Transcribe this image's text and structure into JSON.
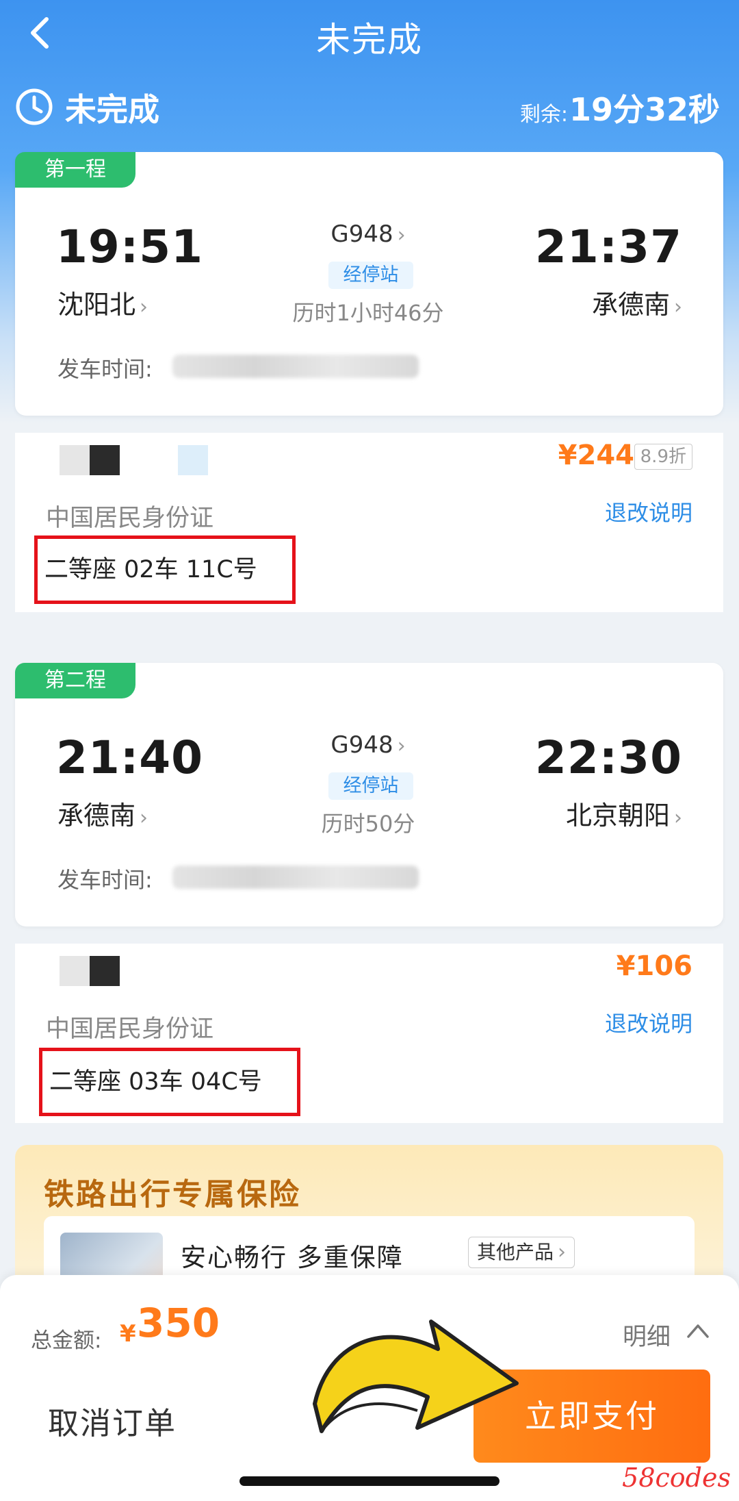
{
  "nav": {
    "title": "未完成"
  },
  "status": {
    "text": "未完成",
    "remain_label": "剩余:",
    "remain_value": "19分32秒"
  },
  "legs": [
    {
      "tag": "第一程",
      "dep_time": "19:51",
      "dep_station": "沈阳北",
      "train_no": "G948",
      "stops": "经停站",
      "duration": "历时1小时46分",
      "arr_time": "21:37",
      "arr_station": "承德南",
      "depart_label": "发车时间:",
      "price": "¥244",
      "discount": "8.9折",
      "id_type": "中国居民身份证",
      "refund": "退改说明",
      "seat": "二等座 02车 11C号"
    },
    {
      "tag": "第二程",
      "dep_time": "21:40",
      "dep_station": "承德南",
      "train_no": "G948",
      "stops": "经停站",
      "duration": "历时50分",
      "arr_time": "22:30",
      "arr_station": "北京朝阳",
      "depart_label": "发车时间:",
      "price": "¥106",
      "id_type": "中国居民身份证",
      "refund": "退改说明",
      "seat": "二等座 03车 04C号"
    }
  ],
  "insurance": {
    "title": "铁路出行专属保险",
    "slogan": "安心畅行 多重保障",
    "other": "其他产品"
  },
  "footer": {
    "total_label": "总金额:",
    "currency": "¥",
    "total_value": "350",
    "detail": "明细",
    "cancel": "取消订单",
    "pay": "立即支付"
  },
  "watermark": "58codes",
  "colors": {
    "accent_blue": "#3d93f0",
    "orange": "#ff7a1a",
    "green": "#2dbd6e",
    "red_box": "#e5121a"
  },
  "icons": [
    "back-icon",
    "clock-icon",
    "chevron-right-icon",
    "chevron-up-icon",
    "pointing-arrow"
  ]
}
